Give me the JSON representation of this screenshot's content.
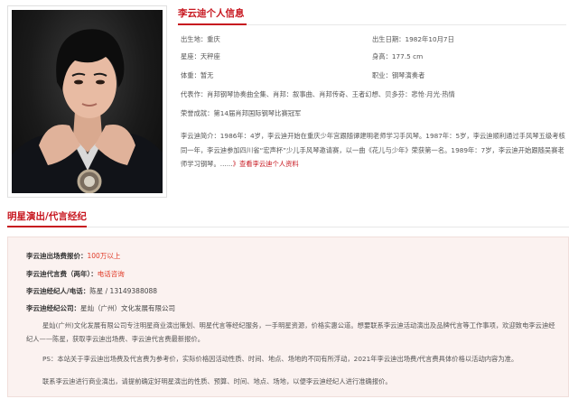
{
  "profile": {
    "title": "李云迪个人信息",
    "birthplace": "出生地：重庆",
    "birthdate": "出生日期：1982年10月7日",
    "zodiac": "星座：天秤座",
    "height": "身高：177.5 cm",
    "weight": "体重：暂无",
    "occupation": "职业：钢琴演奏者",
    "works": "代表作：肖邦钢琴协奏曲全集、肖邦：叙事曲、肖邦传奇、王者幻想、贝多芬：悲怆·月光·热情",
    "honors": "荣誉成就：第14届肖邦国际钢琴比赛冠军",
    "bio": "李云迪简介：1986年：4岁，李云迪开始在重庆少年宫跟随谭建明老师学习手风琴。1987年：5岁，李云迪顺利通过手风琴五级考核同一年，李云迪参加四川省“宏声杯”少儿手风琴邀请赛，以一曲《花儿与少年》荣获第一名。1989年：7岁，李云迪开始跟随吴赛老师学习钢琴。......",
    "more_link": "》查看李云迪个人资料"
  },
  "section": {
    "title": "明星演出/代言经纪"
  },
  "booking": {
    "fee_label": "李云迪出场费报价：",
    "fee_value": "100万以上",
    "endorse_label": "李云迪代言费（两年）：",
    "endorse_value": "电话咨询",
    "agent_label": "李云迪经纪人/电话：",
    "agent_value": "陈星 / 13149388088",
    "company_label": "李云迪经纪公司：",
    "company_value": "星灿（广州）文化发展有限公司",
    "para1": "星灿(广州)文化发展有限公司专注明星商业演出策划、明星代言等经纪服务，一手明星资源，价格实惠公道。想要联系李云迪活动演出及品牌代言等工作事项，欢迎致电李云迪经纪人——陈星，获取李云迪出场费、李云迪代言费最新报价。",
    "para2": "PS：本站关于李云迪出场费及代言费为参考价，实际价格因活动性质、时间、地点、场地的不同有所浮动，2021年李云迪出场费/代言费具体价格以活动内容为准。",
    "para3": "联系李云迪进行商业演出，请提前确定好明星演出的性质、预算、时间、地点、场地，以便李云迪经纪人进行准确报价。"
  },
  "colors": {
    "accent": "#c7161f",
    "price": "#e03a27",
    "panel_bg": "#fbf2f0"
  }
}
